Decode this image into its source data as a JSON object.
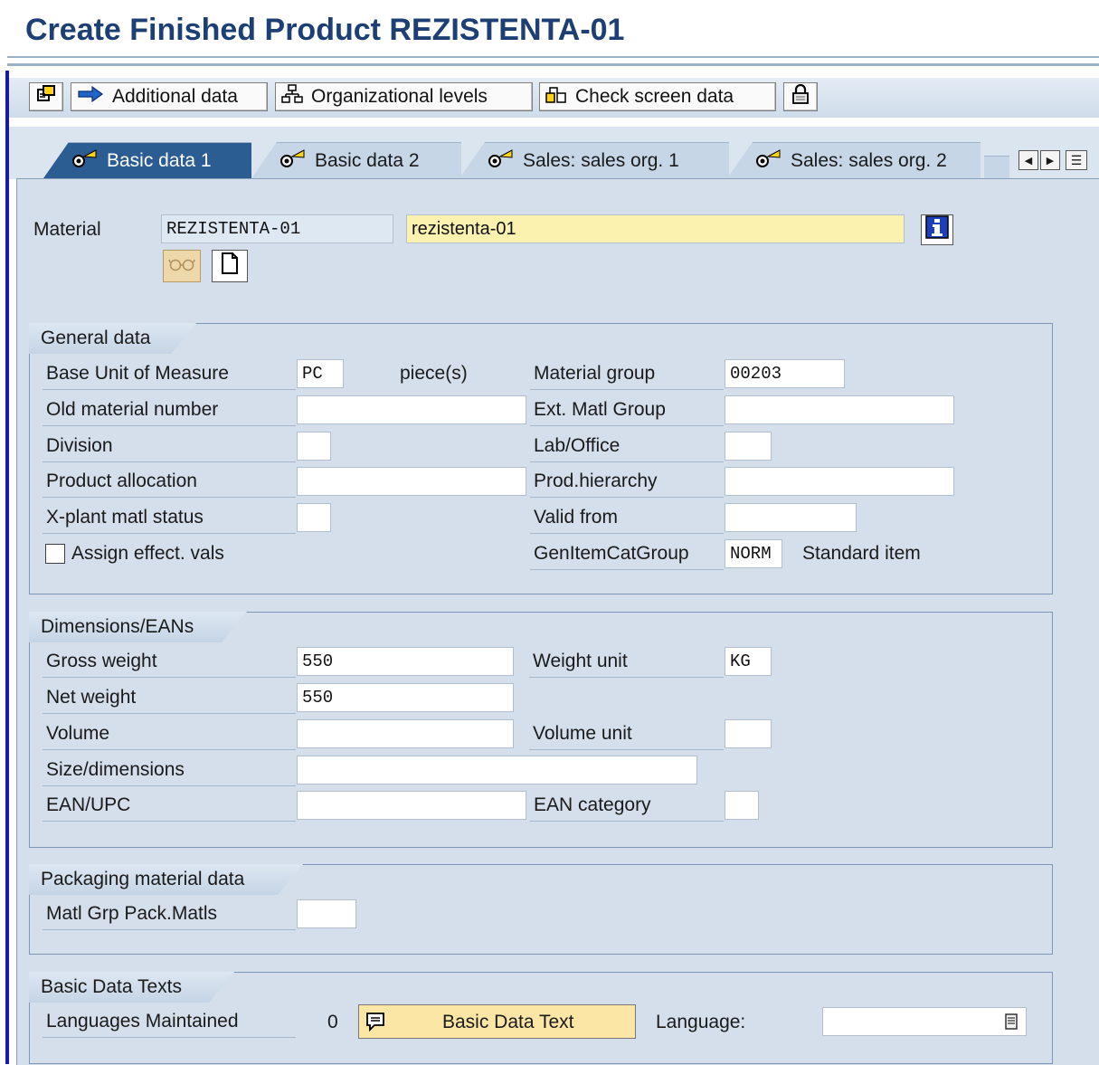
{
  "page": {
    "title": "Create Finished Product REZISTENTA-01"
  },
  "toolbar": {
    "additional_data": "Additional data",
    "org_levels": "Organizational levels",
    "check_screen": "Check screen data"
  },
  "tabs": [
    {
      "label": "Basic data 1",
      "active": true
    },
    {
      "label": "Basic data 2",
      "active": false
    },
    {
      "label": "Sales: sales org. 1",
      "active": false
    },
    {
      "label": "Sales: sales org. 2",
      "active": false
    }
  ],
  "material": {
    "label": "Material",
    "number": "REZISTENTA-01",
    "description": "rezistenta-01"
  },
  "general_data": {
    "title": "General data",
    "base_uom_label": "Base Unit of Measure",
    "base_uom_value": "PC",
    "base_uom_text": "piece(s)",
    "material_group_label": "Material group",
    "material_group_value": "00203",
    "old_material_label": "Old material number",
    "old_material_value": "",
    "ext_matl_group_label": "Ext. Matl Group",
    "ext_matl_group_value": "",
    "division_label": "Division",
    "division_value": "",
    "lab_office_label": "Lab/Office",
    "lab_office_value": "",
    "product_allocation_label": "Product allocation",
    "product_allocation_value": "",
    "prod_hierarchy_label": "Prod.hierarchy",
    "prod_hierarchy_value": "",
    "xplant_status_label": "X-plant matl status",
    "xplant_status_value": "",
    "valid_from_label": "Valid from",
    "valid_from_value": "",
    "assign_effect_label": "Assign effect. vals",
    "assign_effect_checked": false,
    "gen_item_cat_label": "GenItemCatGroup",
    "gen_item_cat_value": "NORM",
    "gen_item_cat_text": "Standard item"
  },
  "dimensions": {
    "title": "Dimensions/EANs",
    "gross_weight_label": "Gross weight",
    "gross_weight_value": "550",
    "weight_unit_label": "Weight unit",
    "weight_unit_value": "KG",
    "net_weight_label": "Net weight",
    "net_weight_value": "550",
    "volume_label": "Volume",
    "volume_value": "",
    "volume_unit_label": "Volume unit",
    "volume_unit_value": "",
    "size_label": "Size/dimensions",
    "size_value": "",
    "ean_label": "EAN/UPC",
    "ean_value": "",
    "ean_category_label": "EAN category",
    "ean_category_value": ""
  },
  "packaging": {
    "title": "Packaging material data",
    "matl_grp_label": "Matl Grp Pack.Matls",
    "matl_grp_value": ""
  },
  "texts": {
    "title": "Basic Data Texts",
    "languages_label": "Languages Maintained",
    "languages_count": "0",
    "basic_text_button": "Basic Data Text",
    "language_label": "Language:",
    "language_value": ""
  },
  "colors": {
    "title": "#1d3f74",
    "active_tab": "#2b5d93",
    "required_field": "#fbf2b0",
    "panel": "#d4dfeb"
  }
}
